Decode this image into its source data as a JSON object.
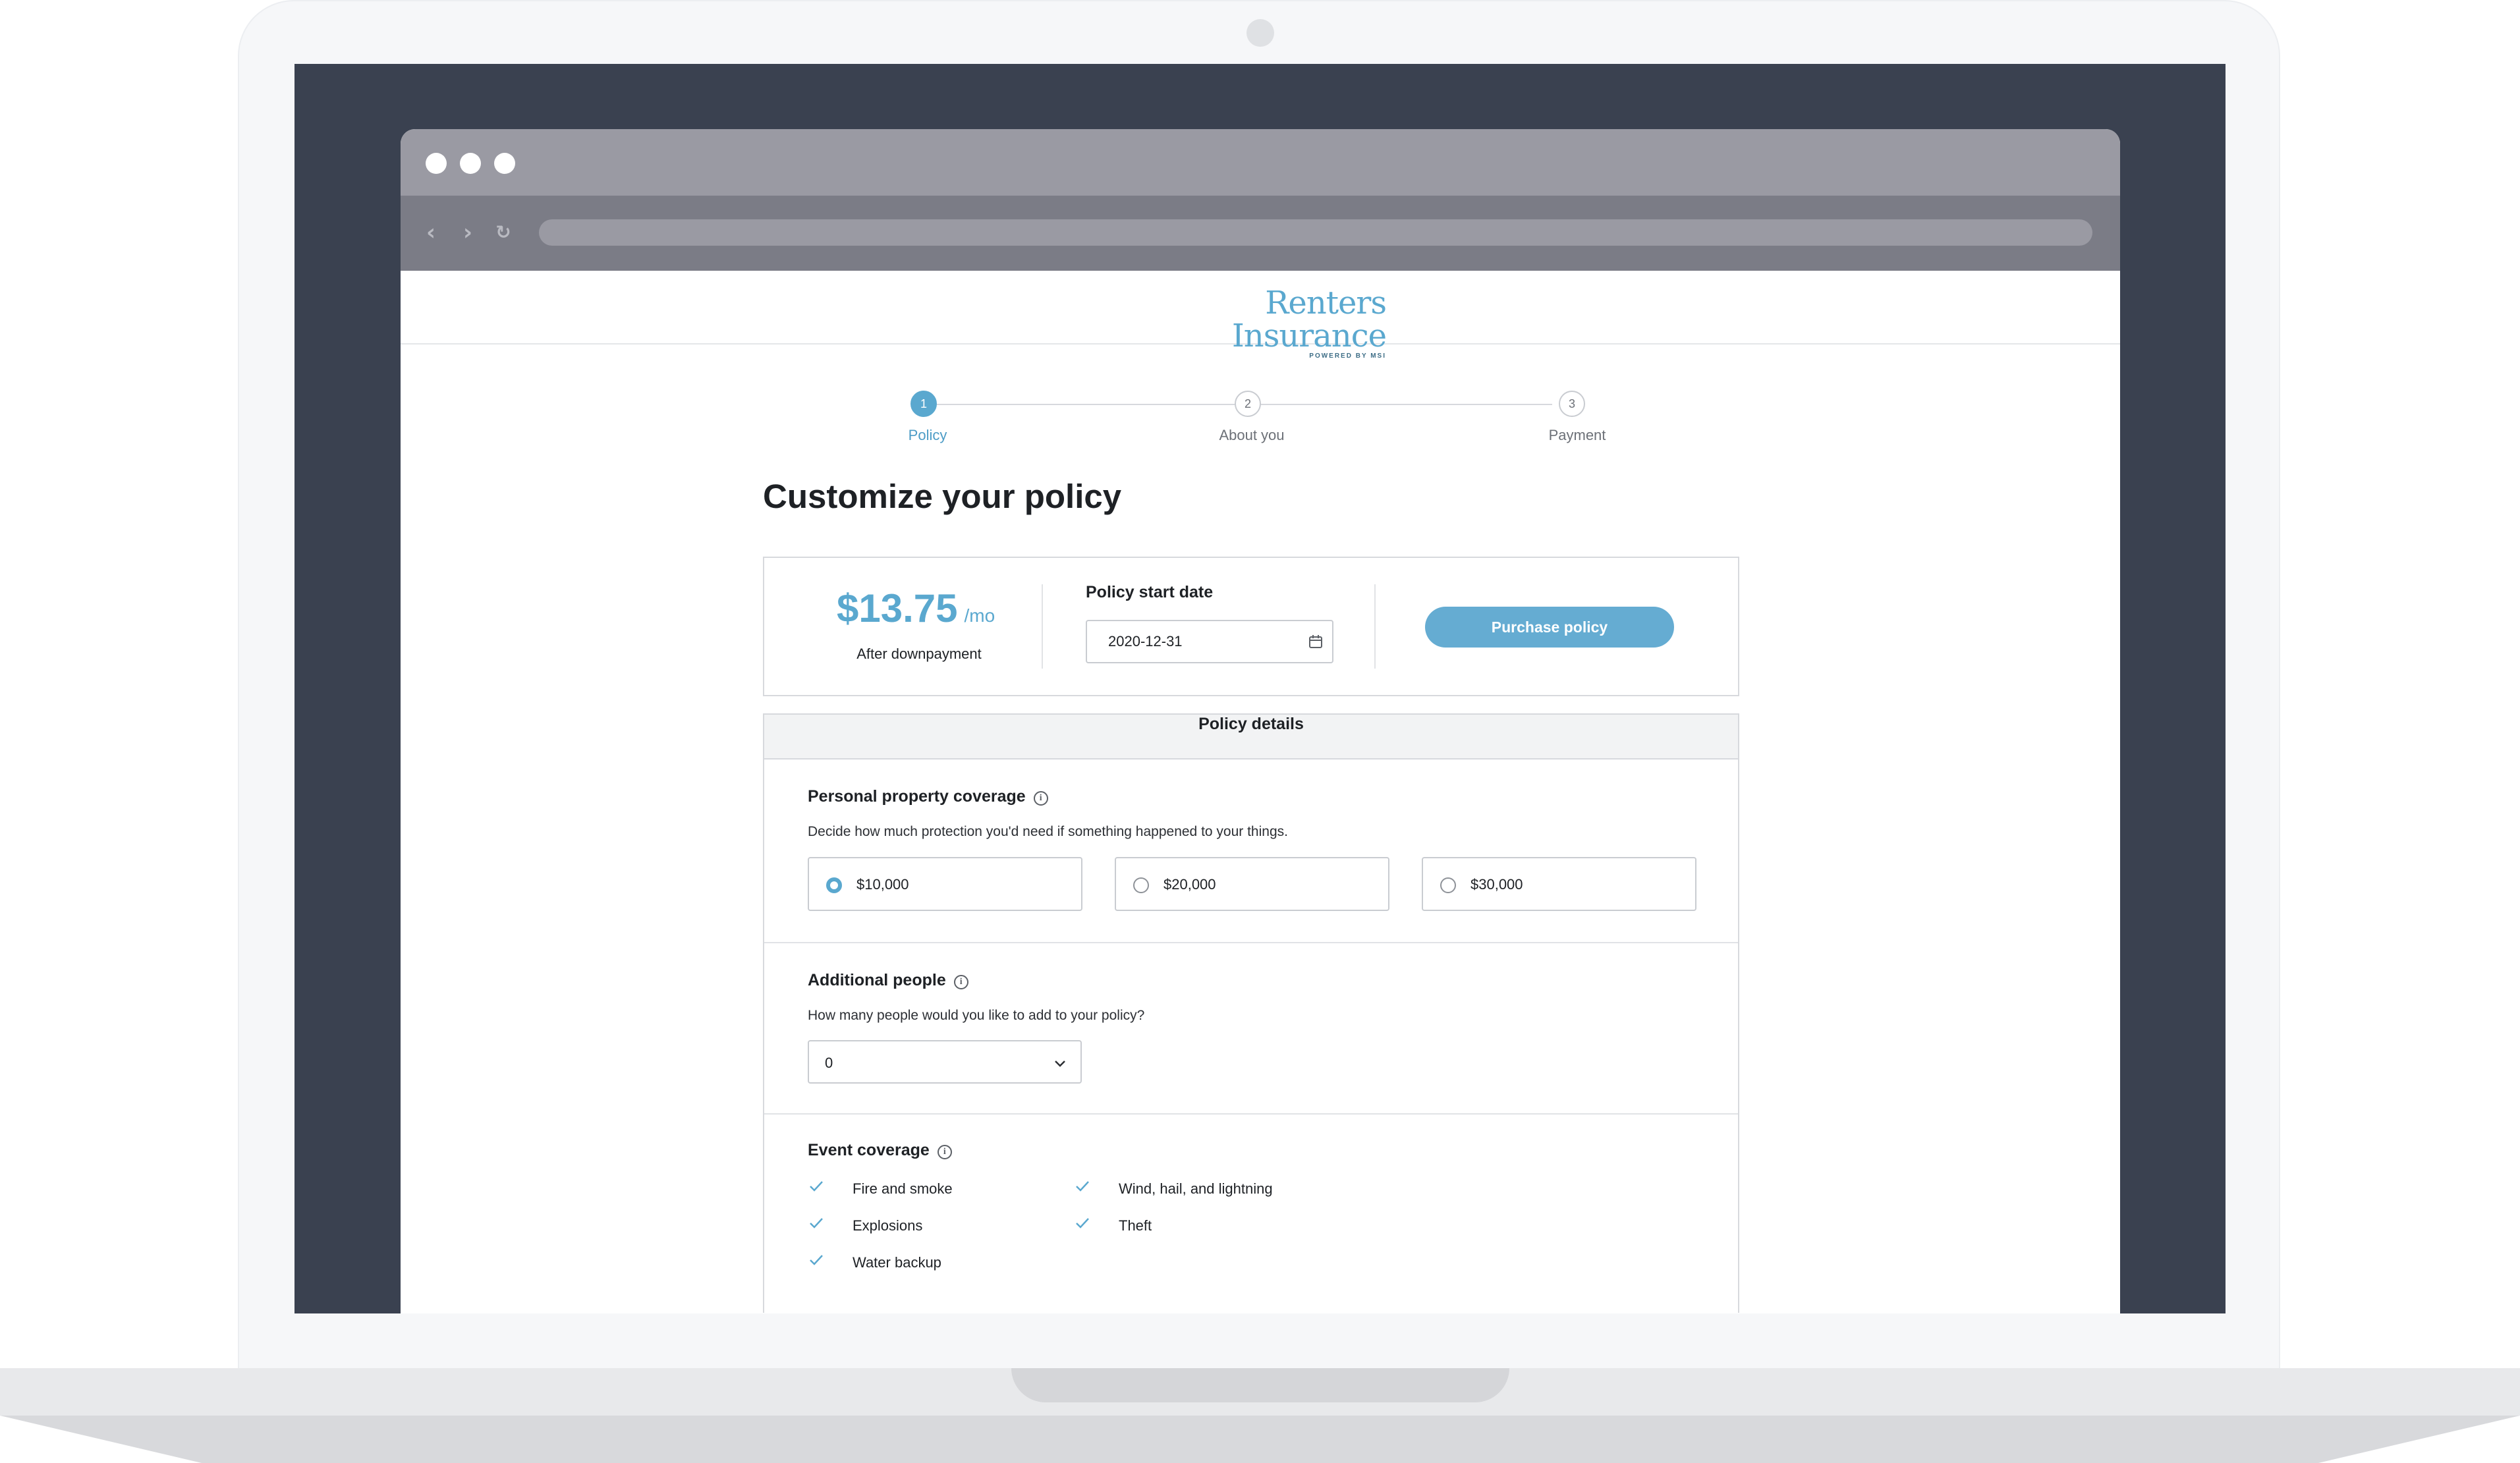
{
  "app": {
    "logo_main": "Renters Insurance",
    "logo_sub": "POWERED BY MSI"
  },
  "stepper": {
    "steps": [
      {
        "number": "1",
        "label": "Policy",
        "active": true
      },
      {
        "number": "2",
        "label": "About you",
        "active": false
      },
      {
        "number": "3",
        "label": "Payment",
        "active": false
      }
    ]
  },
  "page_title": "Customize your policy",
  "summary": {
    "price": "$13.75",
    "price_unit": "/mo",
    "price_note": "After downpayment",
    "start_date_label": "Policy start date",
    "start_date_value": "2020-12-31",
    "purchase_label": "Purchase policy"
  },
  "details": {
    "header": "Policy details",
    "property": {
      "title": "Personal property coverage",
      "description": "Decide how much protection you'd need if something happened to your things.",
      "options": [
        {
          "label": "$10,000",
          "selected": true
        },
        {
          "label": "$20,000",
          "selected": false
        },
        {
          "label": "$30,000",
          "selected": false
        }
      ]
    },
    "people": {
      "title": "Additional people",
      "description": "How many people would you like to add to your policy?",
      "selected": "0"
    },
    "events": {
      "title": "Event coverage",
      "items": [
        "Fire and smoke",
        "Explosions",
        "Water backup",
        "Wind, hail, and lightning",
        "Theft"
      ]
    }
  },
  "colors": {
    "accent": "#5aa8cf",
    "bezel": "#3a4150",
    "chrome": "#9a9aa3"
  },
  "icons": [
    "info-icon",
    "calendar-icon",
    "chevron-down-icon",
    "check-icon",
    "back-icon",
    "forward-icon",
    "reload-icon"
  ]
}
